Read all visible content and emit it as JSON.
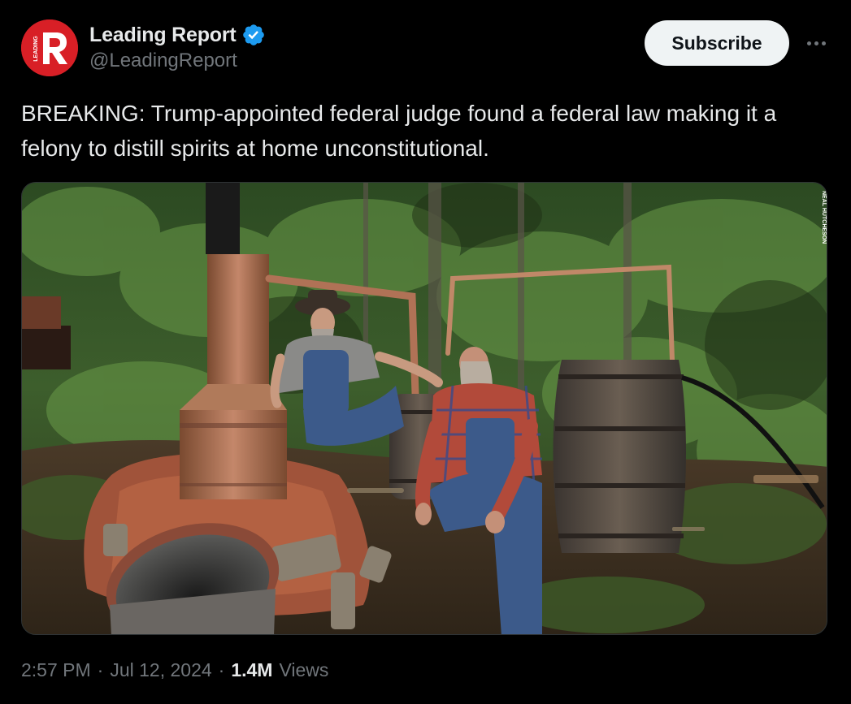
{
  "author": {
    "display_name": "Leading Report",
    "handle": "@LeadingReport",
    "avatar_letter": "R",
    "avatar_side_text": "LEADING",
    "avatar_color": "#d81f26",
    "verified": true,
    "verified_color": "#1d9bf0"
  },
  "actions": {
    "subscribe_label": "Subscribe",
    "more_icon": "more-horizontal-icon"
  },
  "tweet": {
    "text": "BREAKING: Trump-appointed federal judge found a federal law making it a felony to distill spirits at home unconstitutional."
  },
  "media": {
    "watermark": "NEAL HUTCHESON"
  },
  "meta": {
    "time": "2:57 PM",
    "separator1": "·",
    "date": "Jul 12, 2024",
    "separator2": "·",
    "views_count": "1.4M",
    "views_label": "Views"
  },
  "colors": {
    "background": "#000000",
    "text_primary": "#e7e9ea",
    "text_secondary": "#71767b",
    "button_bg": "#eff3f4"
  }
}
